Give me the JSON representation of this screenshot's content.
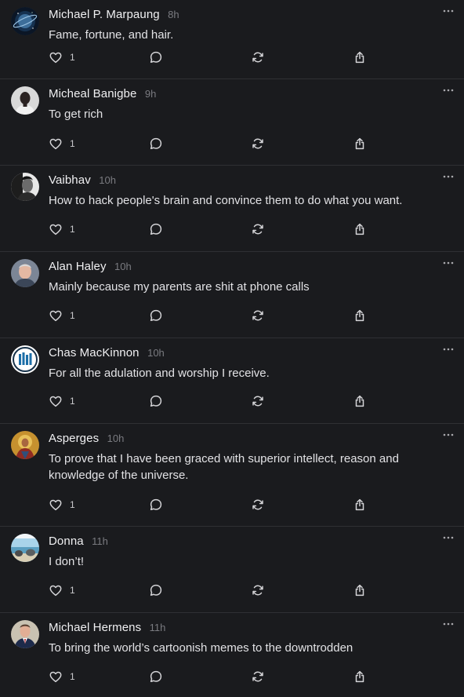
{
  "posts": [
    {
      "author": "Michael P. Marpaung",
      "time": "8h",
      "text": "Fame, fortune, and hair.",
      "likes": "1",
      "avatar": "space"
    },
    {
      "author": "Micheal Banigbe",
      "time": "9h",
      "text": "To get rich",
      "likes": "1",
      "avatar": "portrait-light"
    },
    {
      "author": "Vaibhav",
      "time": "10h",
      "text": "How to hack people's brain and convince them to do what you want.",
      "likes": "1",
      "avatar": "portrait-bw"
    },
    {
      "author": "Alan Haley",
      "time": "10h",
      "text": "Mainly because my parents are shit at phone calls",
      "likes": "1",
      "avatar": "portrait-grey"
    },
    {
      "author": "Chas MacKinnon",
      "time": "10h",
      "text": "For all the adulation and worship I receive.",
      "likes": "1",
      "avatar": "bars-logo"
    },
    {
      "author": "Asperges",
      "time": "10h",
      "text": "To prove that I have been graced with superior intellect, reason and knowledge of the universe.",
      "likes": "1",
      "avatar": "icon-painting"
    },
    {
      "author": "Donna",
      "time": "11h",
      "text": "I don’t!",
      "likes": "1",
      "avatar": "beach"
    },
    {
      "author": "Michael Hermens",
      "time": "11h",
      "text": "To bring the world’s cartoonish memes to the downtrodden",
      "likes": "1",
      "avatar": "portrait-suit"
    }
  ],
  "icons": {
    "more": "more-options-icon",
    "like": "heart-icon",
    "reply": "comment-icon",
    "repost": "repost-icon",
    "share": "share-icon"
  },
  "colors": {
    "background": "#1a1b1e",
    "divider": "#2f3034",
    "text": "#e2e2e5",
    "muted": "#7a7b80"
  }
}
